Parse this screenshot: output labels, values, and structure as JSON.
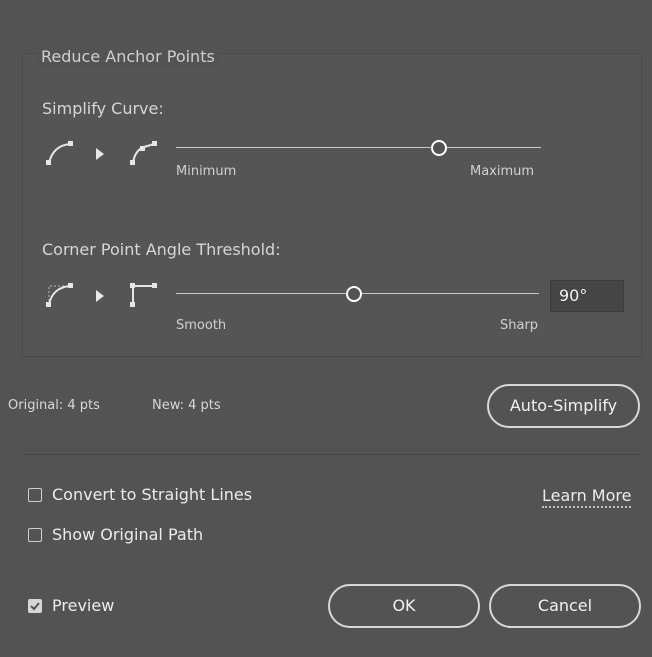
{
  "group": {
    "title": "Reduce Anchor Points"
  },
  "simplify": {
    "label": "Simplify Curve:",
    "min_label": "Minimum",
    "max_label": "Maximum",
    "value_fraction": 0.72
  },
  "corner": {
    "label": "Corner Point Angle Threshold:",
    "min_label": "Smooth",
    "max_label": "Sharp",
    "value_fraction": 0.49,
    "field_value": "90°"
  },
  "stats": {
    "original": "Original: 4 pts",
    "new": "New: 4 pts"
  },
  "buttons": {
    "auto_simplify": "Auto-Simplify",
    "ok": "OK",
    "cancel": "Cancel"
  },
  "options": {
    "convert_straight": {
      "label": "Convert to Straight Lines",
      "checked": false
    },
    "show_original": {
      "label": "Show Original Path",
      "checked": false
    },
    "preview": {
      "label": "Preview",
      "checked": true
    }
  },
  "learn_more": "Learn More",
  "icons": [
    "curve-icon",
    "arrow-right-icon",
    "simplified-curve-icon",
    "corner-curve-icon",
    "corner-point-icon",
    "checkmark-icon"
  ]
}
